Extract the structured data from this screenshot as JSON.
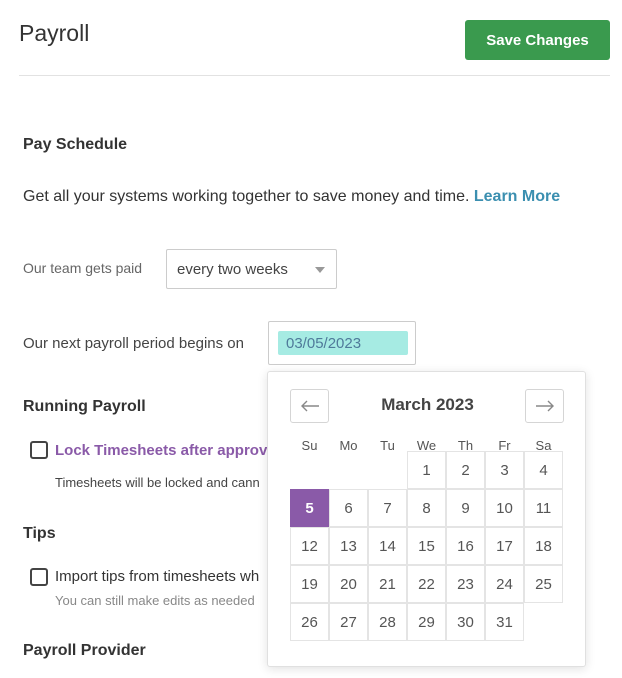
{
  "header": {
    "title": "Payroll",
    "save_label": "Save Changes"
  },
  "pay_schedule": {
    "heading": "Pay Schedule",
    "intro_text": "Get all your systems working together to save money and time. ",
    "learn_more": "Learn More",
    "team_label": "Our team gets paid",
    "frequency": "every two weeks",
    "period_label": "Our next payroll period begins on",
    "period_date": "03/05/2023"
  },
  "running_payroll": {
    "heading": "Running Payroll",
    "lock_label": "Lock Timesheets after approva",
    "lock_desc": "Timesheets will be locked and cann"
  },
  "tips": {
    "heading": "Tips",
    "import_label": "Import tips from timesheets wh",
    "import_desc": "You can still make edits as needed"
  },
  "payroll_provider": {
    "heading": "Payroll Provider"
  },
  "calendar": {
    "month_label": "March 2023",
    "prev_icon": "arrow-left-icon",
    "next_icon": "arrow-right-icon",
    "weekdays": [
      "Su",
      "Mo",
      "Tu",
      "We",
      "Th",
      "Fr",
      "Sa"
    ],
    "weeks": [
      [
        "",
        "",
        "",
        "1",
        "2",
        "3",
        "4"
      ],
      [
        "5",
        "6",
        "7",
        "8",
        "9",
        "10",
        "11"
      ],
      [
        "12",
        "13",
        "14",
        "15",
        "16",
        "17",
        "18"
      ],
      [
        "19",
        "20",
        "21",
        "22",
        "23",
        "24",
        "25"
      ],
      [
        "26",
        "27",
        "28",
        "29",
        "30",
        "31",
        ""
      ]
    ],
    "selected_day": "5",
    "selected_color": "#8a5aa8"
  },
  "colors": {
    "save_button": "#3a9a4e",
    "link": "#3b8fb0",
    "date_highlight": "#a6ebe3"
  }
}
